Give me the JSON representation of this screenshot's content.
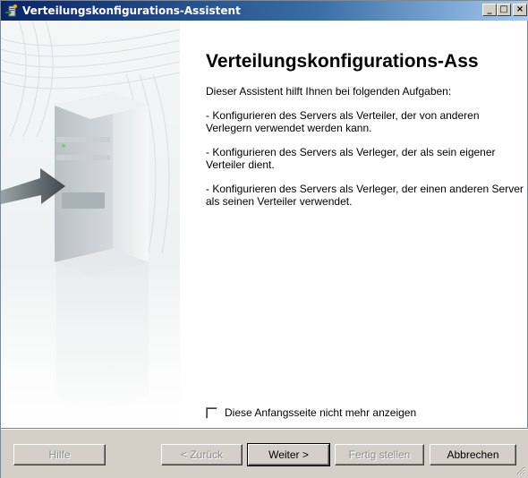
{
  "window": {
    "title": "Verteilungskonfigurations-Assistent",
    "minimize_glyph": "_",
    "maximize_glyph": "□",
    "close_glyph": "×"
  },
  "content": {
    "heading": "Verteilungskonfigurations-Ass",
    "intro": "Dieser Assistent hilft Ihnen bei folgenden Aufgaben:",
    "tasks": [
      "- Konfigurieren des Servers als Verteiler, der von anderen Verlegern verwendet werden kann.",
      "- Konfigurieren des Servers als Verleger, der als sein eigener Verteiler dient.",
      "- Konfigurieren des Servers als Verleger, der einen anderen Server als seinen Verteiler verwendet."
    ]
  },
  "checkbox": {
    "label": "Diese Anfangsseite nicht mehr anzeigen",
    "checked": false
  },
  "buttons": {
    "help": "Hilfe",
    "back": "< Zurück",
    "next": "Weiter >",
    "finish": "Fertig stellen",
    "cancel": "Abbrechen"
  },
  "icons": {
    "title_icon": "wizard-app-icon",
    "illustration": "server-tower-with-arrow-illustration"
  },
  "colors": {
    "titlebar_start": "#0a246a",
    "titlebar_end": "#a6caf0",
    "dialog_face": "#d4d0c8"
  }
}
